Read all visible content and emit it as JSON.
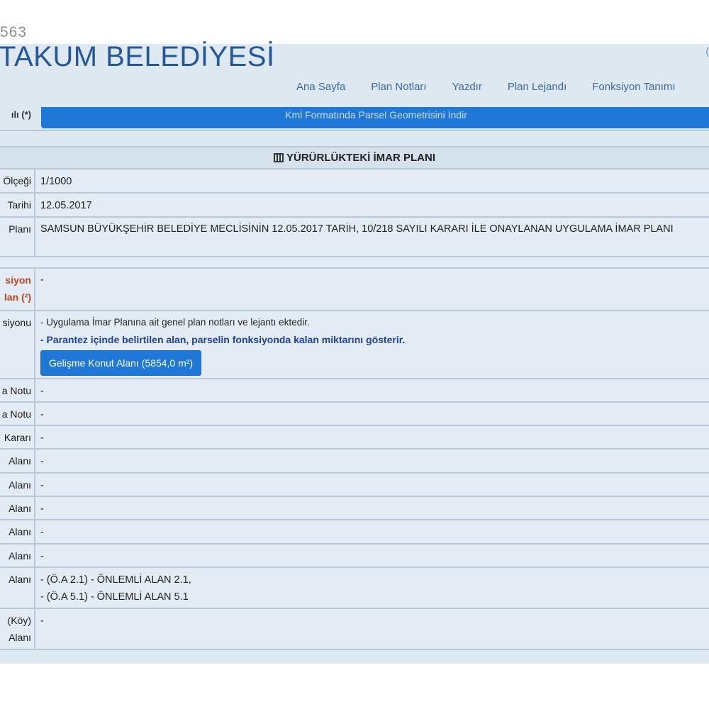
{
  "header": {
    "code": "563",
    "brand": "TAKUM BELEDİYESİ",
    "corner_mark": "("
  },
  "nav": {
    "items": [
      "Ana Sayfa",
      "Plan Notları",
      "Yazdır",
      "Plan Lejandı",
      "Fonksiyon Tanımı"
    ]
  },
  "top_bar": {
    "label": "ılı (*)",
    "text": "Kml Formatında Parsel Geometrisini İndir"
  },
  "section": {
    "title": "YÜRÜRLÜKTEKİ İMAR PLANI"
  },
  "plan_rows": [
    {
      "label": "Ölçeği",
      "value": "1/1000"
    },
    {
      "label": "Tarihi",
      "value": "12.05.2017"
    },
    {
      "label": "Planı",
      "value": "SAMSUN BÜYÜKŞEHİR BELEDİYE MECLİSİNİN 12.05.2017 TARİH, 10/218 SAYILI KARARI İLE ONAYLANAN UYGULAMA İMAR PLANI"
    }
  ],
  "function_block": {
    "area_label_1": "siyon",
    "area_label_2": "lan (²)",
    "area_value": "-",
    "func_label": "siyonu",
    "note_1": "- Uygulama İmar Planına ait genel plan notları ve lejantı ektedir.",
    "note_2": "- Parantez içinde belirtilen alan, parselin fonksiyonda kalan miktarını gösterir.",
    "button_label": "Gelişme Konut Alanı (5854,0 m²)"
  },
  "detail_rows": [
    {
      "label": "a Notu",
      "value": "-"
    },
    {
      "label": "a Notu",
      "value": "-"
    },
    {
      "label": "Kararı",
      "value": "-"
    },
    {
      "label": "Alanı",
      "value": "-"
    },
    {
      "label": "Alanı",
      "value": "-"
    },
    {
      "label": "Alanı",
      "value": "-"
    },
    {
      "label": "Alanı",
      "value": "-"
    },
    {
      "label": "Alanı",
      "value": "-"
    }
  ],
  "risk_row": {
    "label": "Alanı",
    "value_1": "- (Ö.A 2.1) - ÖNLEMLİ ALAN 2.1,",
    "value_2": "- (Ö.A 5.1) - ÖNLEMLİ ALAN 5.1"
  },
  "village_row": {
    "label_1": "(Köy)",
    "label_2": "Alanı",
    "value": "-"
  }
}
